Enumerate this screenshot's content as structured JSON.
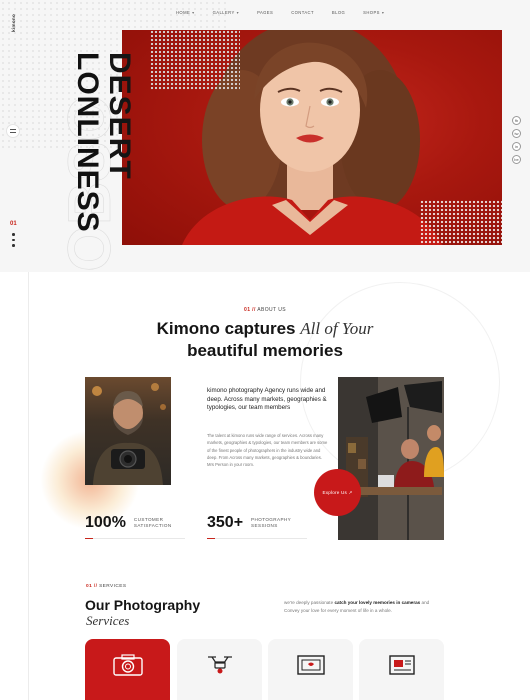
{
  "brand": {
    "logo_text": "kimono"
  },
  "nav": {
    "items": [
      {
        "label": "HOME",
        "caret": "▾"
      },
      {
        "label": "GALLERY",
        "caret": "▾"
      },
      {
        "label": "PAGES",
        "caret": ""
      },
      {
        "label": "CONTACT",
        "caret": ""
      },
      {
        "label": "BLOG",
        "caret": ""
      },
      {
        "label": "SHOPS",
        "caret": "▾"
      }
    ]
  },
  "hero": {
    "title_line1": "DESERT",
    "title_line2": "LONLINESS",
    "slide_number": "01",
    "socials": [
      "fb",
      "tw",
      "in",
      "be"
    ]
  },
  "about": {
    "kicker_num": "01 //",
    "kicker_label": "ABOUT US",
    "heading_line1_bold": "Kimono captures",
    "heading_line1_italic": "All of Your",
    "heading_line2": "beautiful memories",
    "lead": "kimono photography Agency runs wide and deep. Across many markets, geographies & typologies, our team members",
    "body": "The talent at kimono runs wide range of services. Across many markets, geographies & typologies, our team members are some of the finest people of photographers in the industry wide and deep. From Across many markets, geographies & boundaries. Mrs Person in your room.",
    "explore_button": "Explore Us ↗",
    "stats": [
      {
        "value": "100%",
        "label_line1": "CUSTOMER",
        "label_line2": "SATISFACTION"
      },
      {
        "value": "350+",
        "label_line1": "PHOTOGRAPHY",
        "label_line2": "SESSIONS"
      }
    ]
  },
  "services": {
    "kicker_num": "01 //",
    "kicker_label": "SERVICES",
    "heading": "Our Photography",
    "heading_italic": "Services",
    "desc_prefix": "we're deeply passionate",
    "desc_bold": "catch your lovely memories in cameras",
    "desc_suffix": "and Convey your love for every moment of life in a whole.",
    "cards": [
      {
        "icon": "camera-icon",
        "active": true
      },
      {
        "icon": "drone-icon",
        "active": false
      },
      {
        "icon": "photo-frame-icon",
        "active": false
      },
      {
        "icon": "image-gallery-icon",
        "active": false
      }
    ]
  },
  "colors": {
    "accent": "#c8191a",
    "dark": "#151515",
    "hero_red": "#a8180f"
  }
}
